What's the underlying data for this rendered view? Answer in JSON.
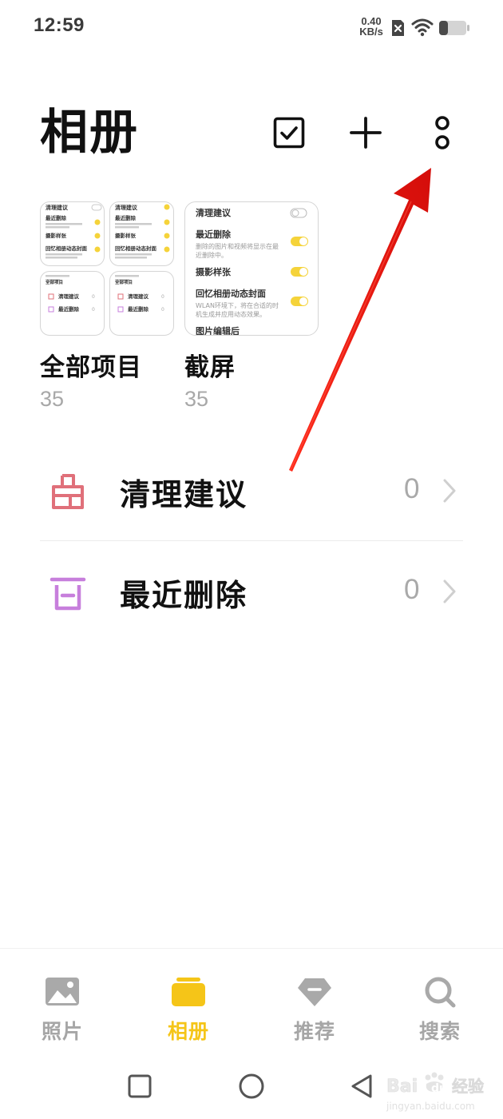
{
  "status_bar": {
    "time": "12:59",
    "net_speed_value": "0.40",
    "net_speed_unit": "KB/s",
    "sim_icon": "no-sim-icon",
    "wifi_icon": "wifi-icon",
    "battery_icon": "battery-icon"
  },
  "header": {
    "title": "相册",
    "actions": [
      "select-icon",
      "add-icon",
      "more-icon"
    ]
  },
  "albums": [
    {
      "name": "全部项目",
      "count": "35",
      "mini_tiles": [
        {
          "line1": "清理建议",
          "line2": "最近删除",
          "line3": "摄影样张",
          "line4": "回忆相册动态封面"
        },
        {
          "line1": "清理建议",
          "line2": "最近删除",
          "line3": "摄影样张",
          "line4": "回忆相册动态封面"
        },
        {
          "line1": "全部项目",
          "line2": "清理建议",
          "line3": "最近删除"
        },
        {
          "line1": "全部项目",
          "line2": "清理建议",
          "line3": "最近删除"
        }
      ]
    },
    {
      "name": "截屏",
      "count": "35",
      "thumb": {
        "clean": "清理建议",
        "recent": "最近删除",
        "recent_desc_1": "删除的图片和视频将显示在最",
        "recent_desc_2": "近删除中。",
        "sample": "摄影样张",
        "memory": "回忆相册动态封面",
        "memory_desc_1": "WLAN环境下，将在合适的时",
        "memory_desc_2": "机生成并应用动态效果。",
        "edit": "图片编辑后"
      }
    }
  ],
  "list": [
    {
      "label": "清理建议",
      "count": "0",
      "icon": "broom-icon",
      "icon_color": "#e0707a"
    },
    {
      "label": "最近删除",
      "count": "0",
      "icon": "trash-icon",
      "icon_color": "#c77fdc"
    }
  ],
  "bottom_nav": {
    "tabs": [
      {
        "label": "照片",
        "icon": "photo-icon",
        "active": false
      },
      {
        "label": "相册",
        "icon": "album-icon",
        "active": true
      },
      {
        "label": "推荐",
        "icon": "diamond-icon",
        "active": false
      },
      {
        "label": "搜索",
        "icon": "search-icon",
        "active": false
      }
    ],
    "active_color": "#f5c518",
    "inactive_color": "#a6a6a6"
  },
  "system_nav": [
    "recents-icon",
    "home-icon",
    "back-icon"
  ],
  "annotation": {
    "arrow_color": "#e8130f"
  },
  "watermark": {
    "brand": "Bai",
    "brand_suffix": "经验",
    "url": "jingyan.baidu.com"
  }
}
